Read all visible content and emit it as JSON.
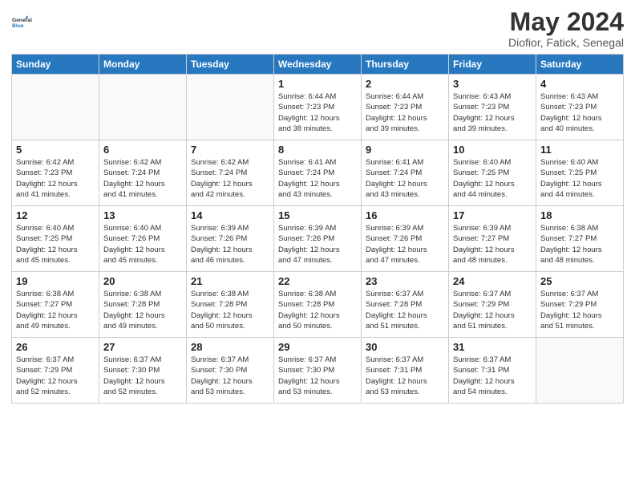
{
  "header": {
    "logo_line1": "General",
    "logo_line2": "Blue",
    "title": "May 2024",
    "subtitle": "Diofior, Fatick, Senegal"
  },
  "days_of_week": [
    "Sunday",
    "Monday",
    "Tuesday",
    "Wednesday",
    "Thursday",
    "Friday",
    "Saturday"
  ],
  "weeks": [
    [
      {
        "num": "",
        "info": ""
      },
      {
        "num": "",
        "info": ""
      },
      {
        "num": "",
        "info": ""
      },
      {
        "num": "1",
        "info": "Sunrise: 6:44 AM\nSunset: 7:23 PM\nDaylight: 12 hours\nand 38 minutes."
      },
      {
        "num": "2",
        "info": "Sunrise: 6:44 AM\nSunset: 7:23 PM\nDaylight: 12 hours\nand 39 minutes."
      },
      {
        "num": "3",
        "info": "Sunrise: 6:43 AM\nSunset: 7:23 PM\nDaylight: 12 hours\nand 39 minutes."
      },
      {
        "num": "4",
        "info": "Sunrise: 6:43 AM\nSunset: 7:23 PM\nDaylight: 12 hours\nand 40 minutes."
      }
    ],
    [
      {
        "num": "5",
        "info": "Sunrise: 6:42 AM\nSunset: 7:23 PM\nDaylight: 12 hours\nand 41 minutes."
      },
      {
        "num": "6",
        "info": "Sunrise: 6:42 AM\nSunset: 7:24 PM\nDaylight: 12 hours\nand 41 minutes."
      },
      {
        "num": "7",
        "info": "Sunrise: 6:42 AM\nSunset: 7:24 PM\nDaylight: 12 hours\nand 42 minutes."
      },
      {
        "num": "8",
        "info": "Sunrise: 6:41 AM\nSunset: 7:24 PM\nDaylight: 12 hours\nand 43 minutes."
      },
      {
        "num": "9",
        "info": "Sunrise: 6:41 AM\nSunset: 7:24 PM\nDaylight: 12 hours\nand 43 minutes."
      },
      {
        "num": "10",
        "info": "Sunrise: 6:40 AM\nSunset: 7:25 PM\nDaylight: 12 hours\nand 44 minutes."
      },
      {
        "num": "11",
        "info": "Sunrise: 6:40 AM\nSunset: 7:25 PM\nDaylight: 12 hours\nand 44 minutes."
      }
    ],
    [
      {
        "num": "12",
        "info": "Sunrise: 6:40 AM\nSunset: 7:25 PM\nDaylight: 12 hours\nand 45 minutes."
      },
      {
        "num": "13",
        "info": "Sunrise: 6:40 AM\nSunset: 7:26 PM\nDaylight: 12 hours\nand 45 minutes."
      },
      {
        "num": "14",
        "info": "Sunrise: 6:39 AM\nSunset: 7:26 PM\nDaylight: 12 hours\nand 46 minutes."
      },
      {
        "num": "15",
        "info": "Sunrise: 6:39 AM\nSunset: 7:26 PM\nDaylight: 12 hours\nand 47 minutes."
      },
      {
        "num": "16",
        "info": "Sunrise: 6:39 AM\nSunset: 7:26 PM\nDaylight: 12 hours\nand 47 minutes."
      },
      {
        "num": "17",
        "info": "Sunrise: 6:39 AM\nSunset: 7:27 PM\nDaylight: 12 hours\nand 48 minutes."
      },
      {
        "num": "18",
        "info": "Sunrise: 6:38 AM\nSunset: 7:27 PM\nDaylight: 12 hours\nand 48 minutes."
      }
    ],
    [
      {
        "num": "19",
        "info": "Sunrise: 6:38 AM\nSunset: 7:27 PM\nDaylight: 12 hours\nand 49 minutes."
      },
      {
        "num": "20",
        "info": "Sunrise: 6:38 AM\nSunset: 7:28 PM\nDaylight: 12 hours\nand 49 minutes."
      },
      {
        "num": "21",
        "info": "Sunrise: 6:38 AM\nSunset: 7:28 PM\nDaylight: 12 hours\nand 50 minutes."
      },
      {
        "num": "22",
        "info": "Sunrise: 6:38 AM\nSunset: 7:28 PM\nDaylight: 12 hours\nand 50 minutes."
      },
      {
        "num": "23",
        "info": "Sunrise: 6:37 AM\nSunset: 7:28 PM\nDaylight: 12 hours\nand 51 minutes."
      },
      {
        "num": "24",
        "info": "Sunrise: 6:37 AM\nSunset: 7:29 PM\nDaylight: 12 hours\nand 51 minutes."
      },
      {
        "num": "25",
        "info": "Sunrise: 6:37 AM\nSunset: 7:29 PM\nDaylight: 12 hours\nand 51 minutes."
      }
    ],
    [
      {
        "num": "26",
        "info": "Sunrise: 6:37 AM\nSunset: 7:29 PM\nDaylight: 12 hours\nand 52 minutes."
      },
      {
        "num": "27",
        "info": "Sunrise: 6:37 AM\nSunset: 7:30 PM\nDaylight: 12 hours\nand 52 minutes."
      },
      {
        "num": "28",
        "info": "Sunrise: 6:37 AM\nSunset: 7:30 PM\nDaylight: 12 hours\nand 53 minutes."
      },
      {
        "num": "29",
        "info": "Sunrise: 6:37 AM\nSunset: 7:30 PM\nDaylight: 12 hours\nand 53 minutes."
      },
      {
        "num": "30",
        "info": "Sunrise: 6:37 AM\nSunset: 7:31 PM\nDaylight: 12 hours\nand 53 minutes."
      },
      {
        "num": "31",
        "info": "Sunrise: 6:37 AM\nSunset: 7:31 PM\nDaylight: 12 hours\nand 54 minutes."
      },
      {
        "num": "",
        "info": ""
      }
    ]
  ]
}
